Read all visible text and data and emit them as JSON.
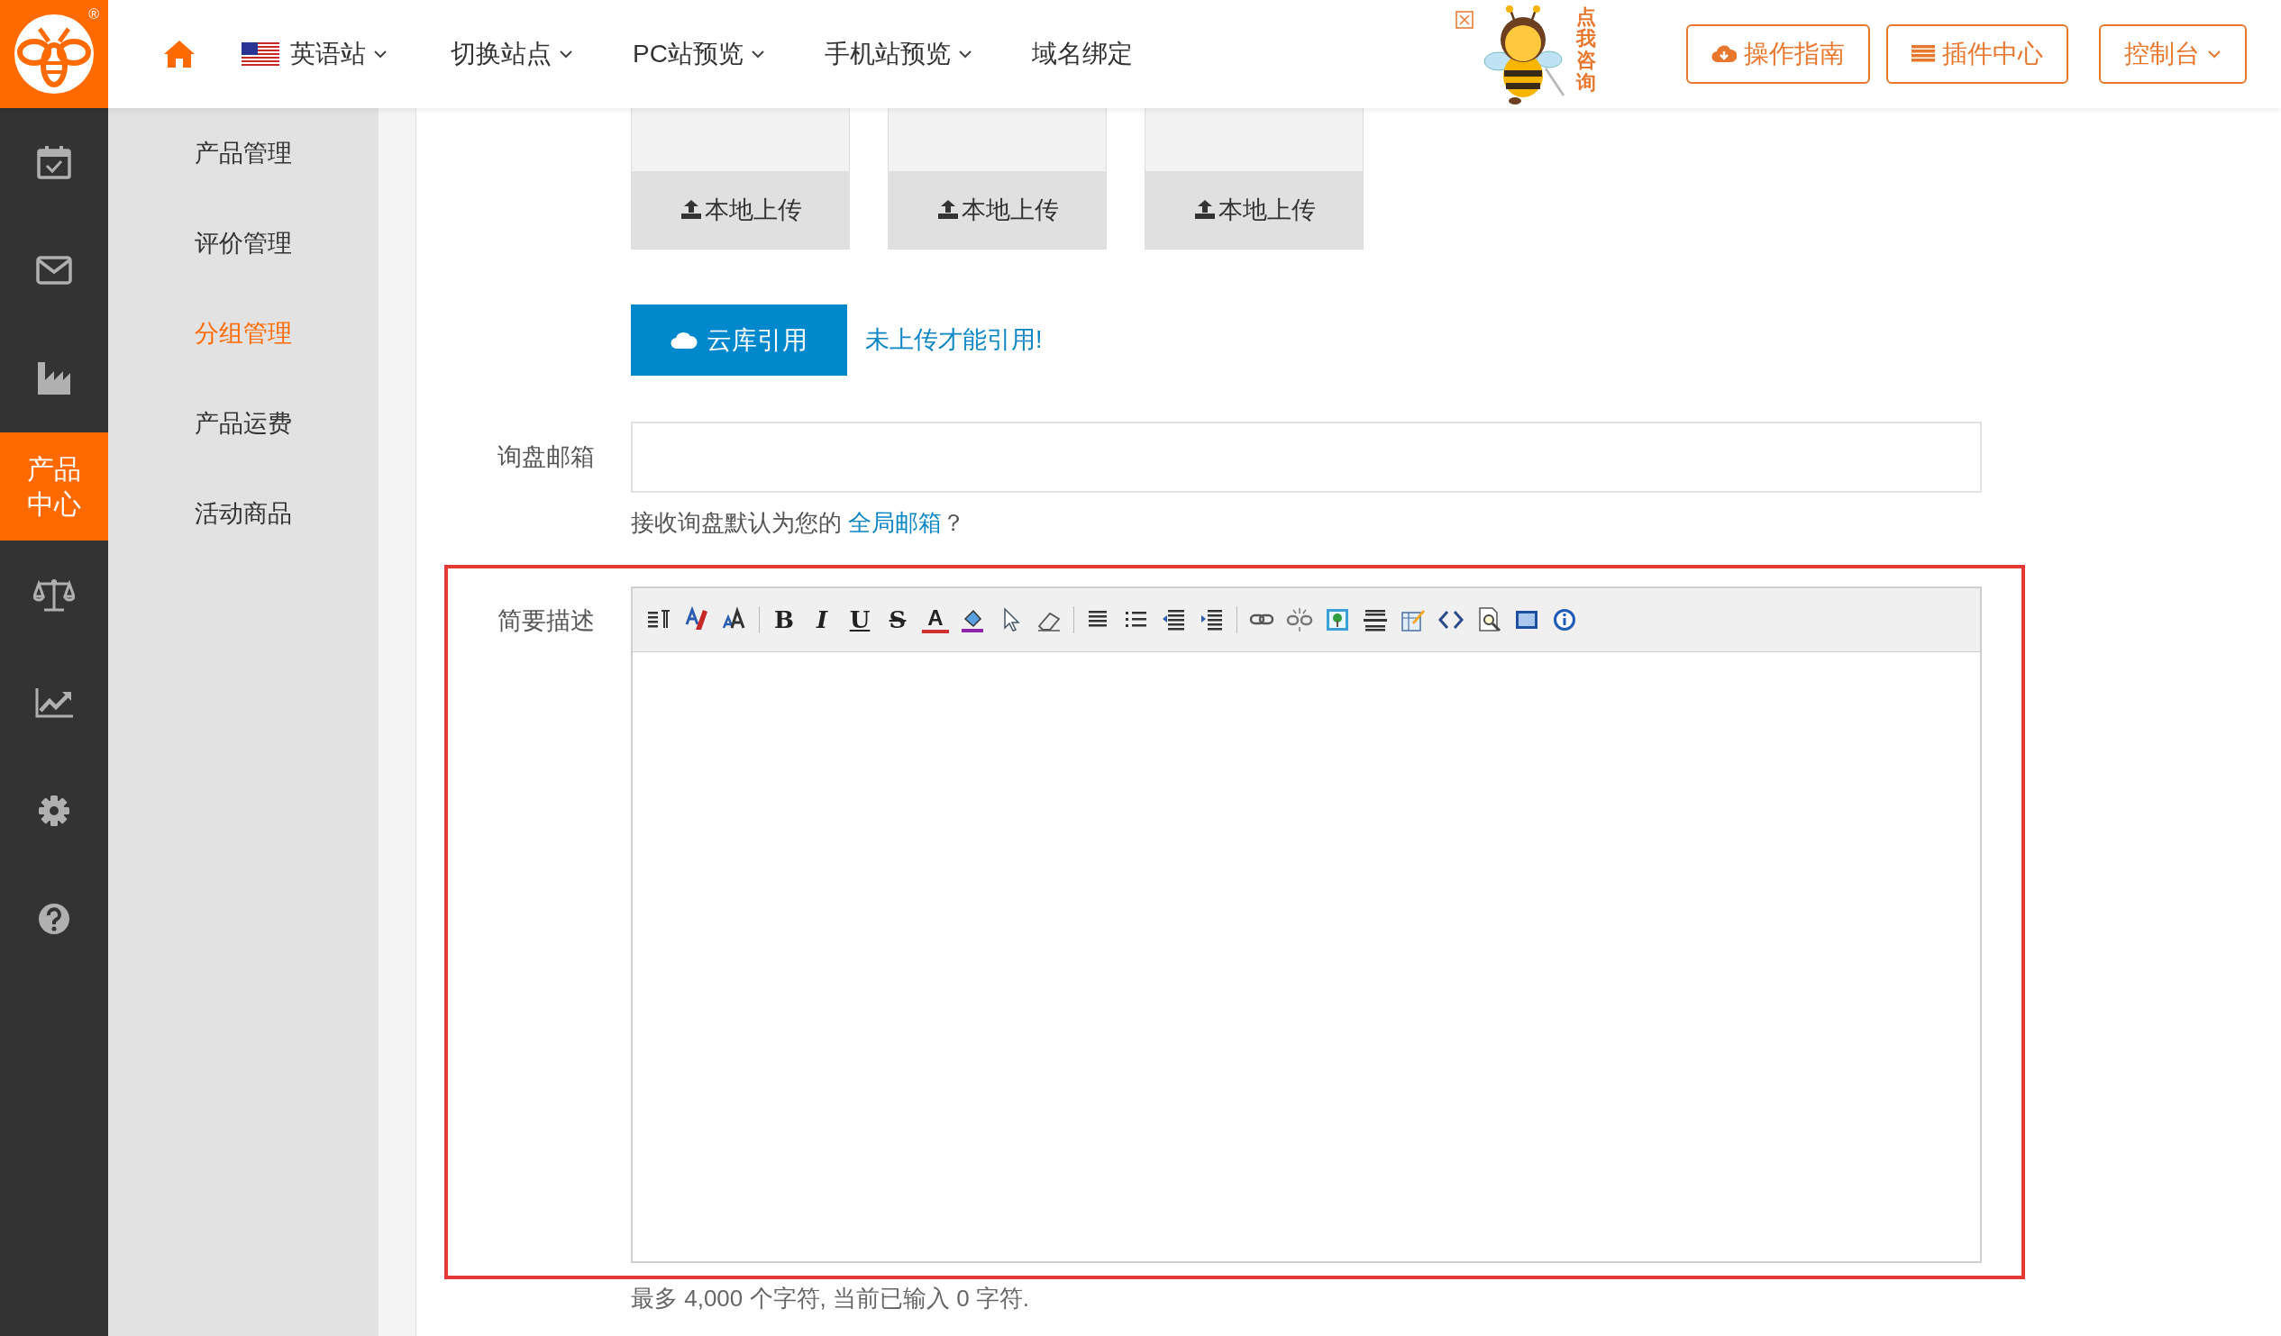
{
  "logo": {
    "mark": "®"
  },
  "nav": [
    {
      "kind": "home"
    },
    {
      "kind": "site",
      "label": "英语站",
      "caret": true
    },
    {
      "kind": "link",
      "label": "切换站点",
      "caret": true
    },
    {
      "kind": "link",
      "label": "PC站预览",
      "caret": true
    },
    {
      "kind": "link",
      "label": "手机站预览",
      "caret": true
    },
    {
      "kind": "link",
      "label": "域名绑定",
      "caret": false
    }
  ],
  "ad": {
    "text": "点我咨询"
  },
  "header_buttons": [
    {
      "kind": "download",
      "label": "操作指南"
    },
    {
      "kind": "list",
      "label": "插件中心"
    },
    {
      "kind": "dropdown",
      "label": "控制台"
    }
  ],
  "rail": [
    {
      "kind": "calendar",
      "selected": false
    },
    {
      "kind": "mail",
      "selected": false
    },
    {
      "kind": "factory",
      "selected": false
    },
    {
      "kind": "text",
      "label": "产品中心",
      "selected": true
    },
    {
      "kind": "scale",
      "selected": false
    },
    {
      "kind": "chart",
      "selected": false
    },
    {
      "kind": "gear",
      "selected": false
    },
    {
      "kind": "help",
      "selected": false
    }
  ],
  "submenu": [
    {
      "label": "产品管理",
      "selected": false
    },
    {
      "label": "评价管理",
      "selected": false
    },
    {
      "label": "分组管理",
      "selected": true
    },
    {
      "label": "产品运费",
      "selected": false
    },
    {
      "label": "活动商品",
      "selected": false
    }
  ],
  "uploads": [
    {
      "label": "本地上传"
    },
    {
      "label": "本地上传"
    },
    {
      "label": "本地上传"
    }
  ],
  "cloud_button": {
    "label": "云库引用"
  },
  "cloud_note": "未上传才能引用!",
  "inquiry_email": {
    "label": "询盘邮箱",
    "hint": "接收询盘默认为您的 ",
    "hint_link": "全局邮箱",
    "hint_end": "？"
  },
  "description": {
    "label": "简要描述",
    "highlighted": true,
    "toolbar_letters": [
      "B",
      "I",
      "U",
      "S",
      "A"
    ],
    "counter": "最多 4,000 个字符, 当前已输入 0 字符."
  }
}
